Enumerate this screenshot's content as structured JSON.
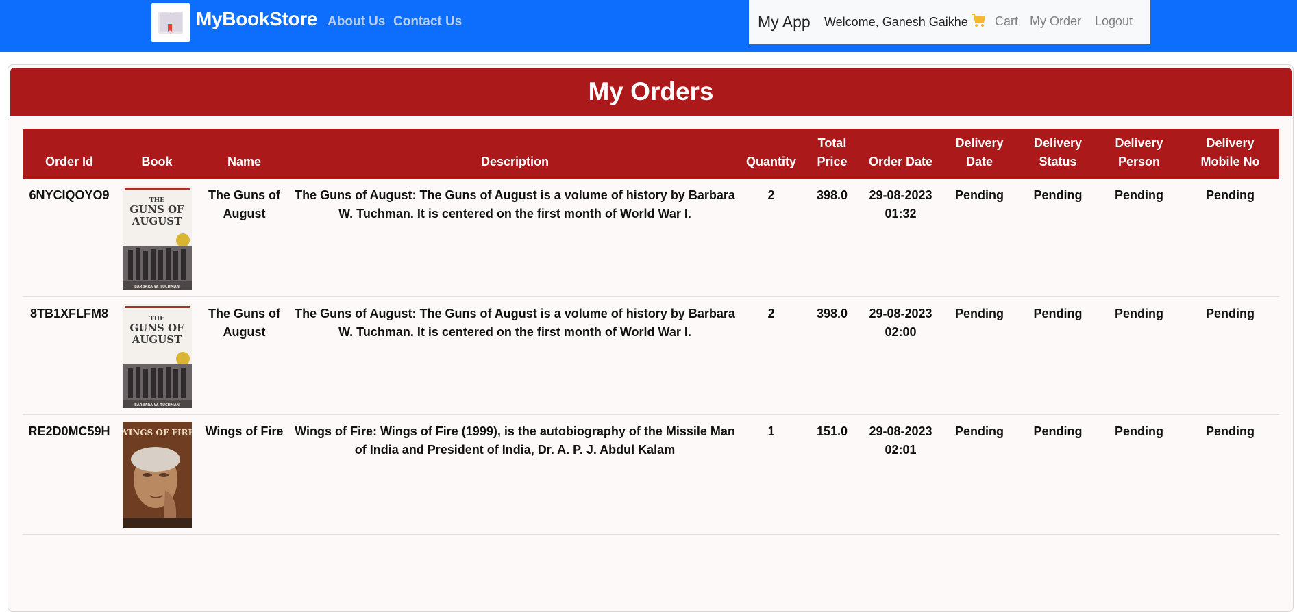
{
  "navbar": {
    "brand": "MyBookStore",
    "links": [
      "About Us",
      "Contact Us"
    ],
    "app_title": "My App",
    "welcome": "Welcome, Ganesh Gaikhe",
    "cart": "Cart",
    "my_order": "My Order",
    "logout": "Logout"
  },
  "page": {
    "title": "My Orders"
  },
  "table": {
    "headers": {
      "order_id": "Order Id",
      "book": "Book",
      "name": "Name",
      "description": "Description",
      "quantity": "Quantity",
      "total_price_1": "Total",
      "total_price_2": "Price",
      "order_date": "Order Date",
      "delivery_date_1": "Delivery",
      "delivery_date_2": "Date",
      "delivery_status_1": "Delivery",
      "delivery_status_2": "Status",
      "delivery_person_1": "Delivery",
      "delivery_person_2": "Person",
      "delivery_mobile_1": "Delivery",
      "delivery_mobile_2": "Mobile No"
    },
    "rows": [
      {
        "order_id": "6NYCIQOYO9",
        "cover": "guns-of-august-cover",
        "name": "The Guns of August",
        "description": "The Guns of August: The Guns of August is a volume of history by Barbara W. Tuchman. It is centered on the first month of World War I.",
        "quantity": "2",
        "total_price": "398.0",
        "order_date": "29-08-2023",
        "order_time": "01:32",
        "delivery_date": "Pending",
        "delivery_status": "Pending",
        "delivery_person": "Pending",
        "delivery_mobile": "Pending"
      },
      {
        "order_id": "8TB1XFLFM8",
        "cover": "guns-of-august-cover",
        "name": "The Guns of August",
        "description": "The Guns of August: The Guns of August is a volume of history by Barbara W. Tuchman. It is centered on the first month of World War I.",
        "quantity": "2",
        "total_price": "398.0",
        "order_date": "29-08-2023",
        "order_time": "02:00",
        "delivery_date": "Pending",
        "delivery_status": "Pending",
        "delivery_person": "Pending",
        "delivery_mobile": "Pending"
      },
      {
        "order_id": "RE2D0MC59H",
        "cover": "wings-of-fire-cover",
        "name": "Wings of Fire",
        "description": "Wings of Fire: Wings of Fire (1999), is the autobiography of the Missile Man of India and President of India, Dr. A. P. J. Abdul Kalam",
        "quantity": "1",
        "total_price": "151.0",
        "order_date": "29-08-2023",
        "order_time": "02:01",
        "delivery_date": "Pending",
        "delivery_status": "Pending",
        "delivery_person": "Pending",
        "delivery_mobile": "Pending"
      }
    ]
  },
  "covers": {
    "guns": {
      "line1": "THE",
      "line2": "GUNS OF",
      "line3": "AUGUST",
      "author": "BARBARA W. TUCHMAN"
    },
    "wings": {
      "title": "WINGS OF FIRE"
    }
  },
  "colors": {
    "navbar": "#0d6efd",
    "header_red": "#ab191b",
    "cart_icon": "#f5b82e"
  },
  "icons": [
    "book-logo-icon",
    "cart-icon"
  ]
}
